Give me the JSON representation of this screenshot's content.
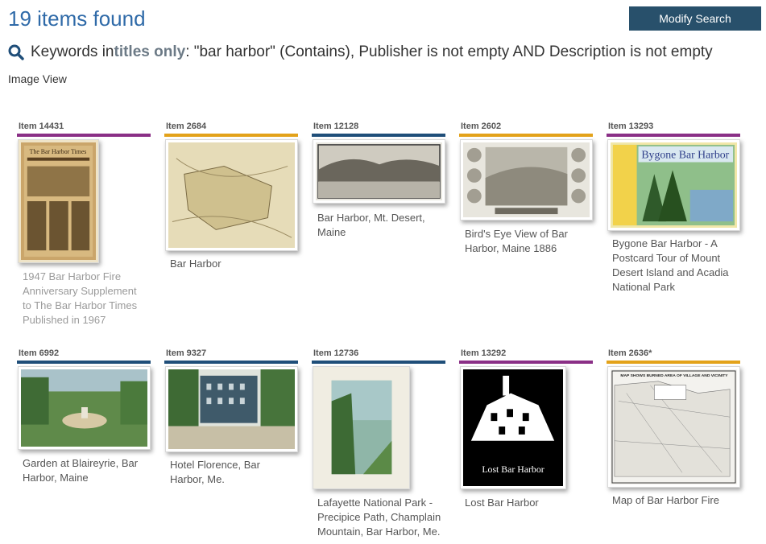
{
  "header": {
    "count_text": "19 items found",
    "modify_label": "Modify Search"
  },
  "query": {
    "icon": "search-icon",
    "prefix": "Keywords in ",
    "scope": "titles only",
    "rest": ": \"bar harbor\" (Contains), Publisher is not empty AND Description is not empty"
  },
  "view_label": "Image View",
  "colors": {
    "accent": "#2f6aa8",
    "button_bg": "#28506b",
    "purple": "#8a2f86",
    "orange": "#e3a21a",
    "blue": "#1f4e79"
  },
  "items": [
    {
      "number": "Item 14431",
      "title": "1947 Bar Harbor Fire Anniversary Supplement to The Bar Harbor Times Published in 1967",
      "bar": "purple",
      "thumb_text": "The Bar Harbor Times"
    },
    {
      "number": "Item 2684",
      "title": "Bar Harbor",
      "bar": "orange"
    },
    {
      "number": "Item 12128",
      "title": "Bar Harbor, Mt. Desert, Maine",
      "bar": "blue"
    },
    {
      "number": "Item 2602",
      "title": "Bird's Eye View of Bar Harbor, Maine 1886",
      "bar": "orange"
    },
    {
      "number": "Item 13293",
      "title": "Bygone Bar Harbor - A Postcard Tour of Mount Desert Island and Acadia National Park",
      "bar": "purple",
      "thumb_text": "Bygone Bar Harbor"
    },
    {
      "number": "Item 6992",
      "title": "Garden at Blaireyrie, Bar Harbor, Maine",
      "bar": "blue"
    },
    {
      "number": "Item 9327",
      "title": "Hotel Florence, Bar Harbor, Me.",
      "bar": "blue"
    },
    {
      "number": "Item 12736",
      "title": "Lafayette National Park - Precipice Path, Champlain Mountain, Bar Harbor, Me.",
      "bar": "blue"
    },
    {
      "number": "Item 13292",
      "title": "Lost Bar Harbor",
      "bar": "purple",
      "thumb_text": "Lost Bar Harbor"
    },
    {
      "number": "Item 2636*",
      "title": "Map of Bar Harbor Fire",
      "bar": "orange",
      "thumb_text": "MAP SHOWS BURNED AREA OF VILLAGE AND VICINITY"
    }
  ]
}
